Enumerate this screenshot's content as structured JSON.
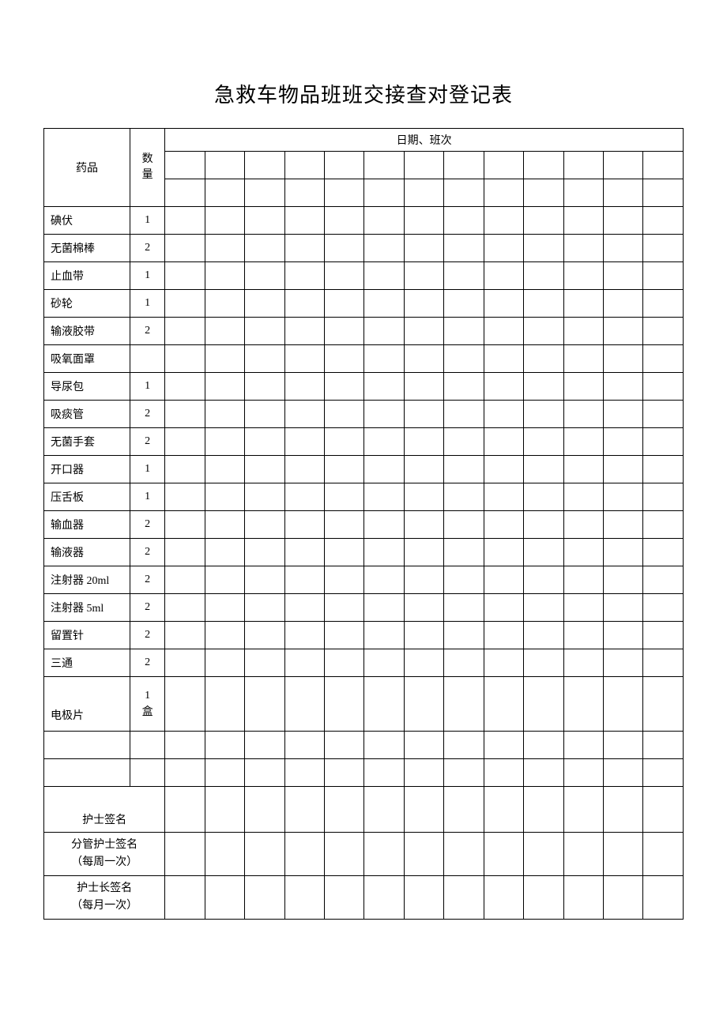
{
  "title": "急救车物品班班交接查对登记表",
  "header": {
    "drug_col": "药品",
    "qty_col": "数量",
    "shift_col": "日期、班次"
  },
  "rows": [
    {
      "name": "碘伏",
      "qty": "1"
    },
    {
      "name": "无菌棉棒",
      "qty": "2"
    },
    {
      "name": "止血带",
      "qty": "1"
    },
    {
      "name": "砂轮",
      "qty": "1"
    },
    {
      "name": "输液胶带",
      "qty": "2"
    },
    {
      "name": "吸氧面罩",
      "qty": ""
    },
    {
      "name": "导尿包",
      "qty": "1"
    },
    {
      "name": "吸痰管",
      "qty": "2"
    },
    {
      "name": "无菌手套",
      "qty": "2"
    },
    {
      "name": "开口器",
      "qty": "1"
    },
    {
      "name": "压舌板",
      "qty": "1"
    },
    {
      "name": "输血器",
      "qty": "2"
    },
    {
      "name": "输液器",
      "qty": "2"
    },
    {
      "name": "注射器 20ml",
      "qty": "2"
    },
    {
      "name": "注射器 5ml",
      "qty": "2"
    },
    {
      "name": "留置针",
      "qty": "2"
    },
    {
      "name": "三通",
      "qty": "2"
    },
    {
      "name": "电极片",
      "qty": "1盒"
    }
  ],
  "blank_rows": [
    "",
    ""
  ],
  "footer": {
    "nurse_sign": "护士签名",
    "charge_nurse_sign_line1": "分管护士签名",
    "charge_nurse_sign_line2": "（每周一次）",
    "head_nurse_sign_line1": "护士长签名",
    "head_nurse_sign_line2": "（每月一次）"
  }
}
